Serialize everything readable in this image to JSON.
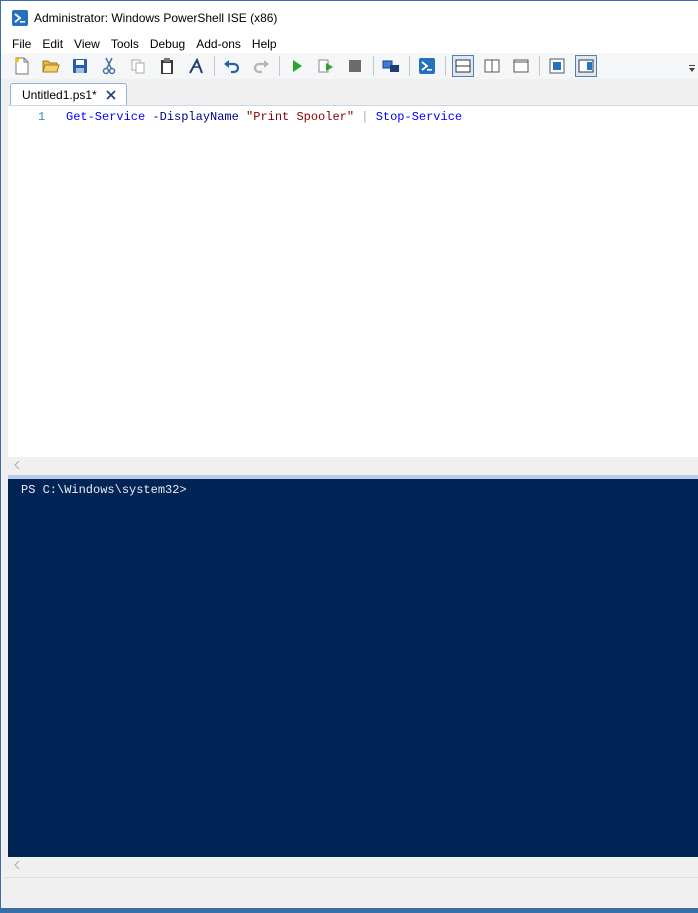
{
  "window": {
    "title": "Administrator: Windows PowerShell ISE (x86)"
  },
  "menu": {
    "items": [
      "File",
      "Edit",
      "View",
      "Tools",
      "Debug",
      "Add-ons",
      "Help"
    ]
  },
  "toolbar": {
    "buttons": [
      "new-file-icon",
      "open-file-icon",
      "save-icon",
      "cut-icon",
      "copy-icon",
      "paste-icon",
      "clear-console-icon",
      "undo-icon",
      "redo-icon",
      "run-script-icon",
      "run-selection-icon",
      "stop-icon",
      "new-remote-tab-icon",
      "start-powershell-icon",
      "show-script-top-icon",
      "show-script-right-icon",
      "show-script-max-icon",
      "show-command-window-icon",
      "show-command-addon-icon"
    ]
  },
  "tabs": [
    {
      "label": "Untitled1.ps1*"
    }
  ],
  "editor": {
    "line_number": "1",
    "tokens": {
      "cmd1": "Get-Service",
      "param": " -DisplayName ",
      "str": "\"Print Spooler\"",
      "pipe": " | ",
      "cmd2": "Stop-Service"
    }
  },
  "console": {
    "prompt": "PS C:\\Windows\\system32>"
  },
  "colors": {
    "console_bg": "#012456",
    "cmdlet": "#0000ff",
    "parameter": "#000080",
    "string": "#8b0000"
  }
}
